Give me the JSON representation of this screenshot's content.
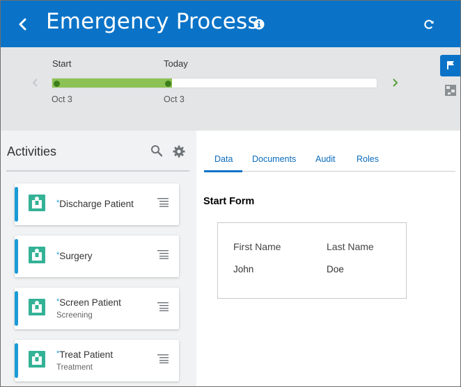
{
  "header": {
    "title": "Emergency Process",
    "back_icon": "chevron-left-icon",
    "info_icon": "info-icon",
    "refresh_icon": "refresh-icon",
    "color": "#0a73c7"
  },
  "timeline": {
    "start_label": "Start",
    "today_label": "Today",
    "start_date": "Oct 3",
    "today_date": "Oct 3",
    "progress_percent": 37,
    "fill_color": "#8cc253",
    "side_buttons": [
      "flag-icon",
      "map-icon"
    ]
  },
  "activities": {
    "title": "Activities",
    "search_icon": "search-icon",
    "gear_icon": "gear-icon",
    "required_mark": "*",
    "items": [
      {
        "name": "Discharge Patient",
        "subtitle": ""
      },
      {
        "name": "Surgery",
        "subtitle": ""
      },
      {
        "name": "Screen Patient",
        "subtitle": "Screening"
      },
      {
        "name": "Treat Patient",
        "subtitle": "Treatment"
      }
    ]
  },
  "tabs": [
    {
      "label": "Data",
      "selected": true
    },
    {
      "label": "Documents",
      "selected": false
    },
    {
      "label": "Audit",
      "selected": false
    },
    {
      "label": "Roles",
      "selected": false
    }
  ],
  "form": {
    "title": "Start Form",
    "fields": [
      {
        "label": "First Name",
        "value": "John"
      },
      {
        "label": "Last Name",
        "value": "Doe"
      }
    ]
  }
}
